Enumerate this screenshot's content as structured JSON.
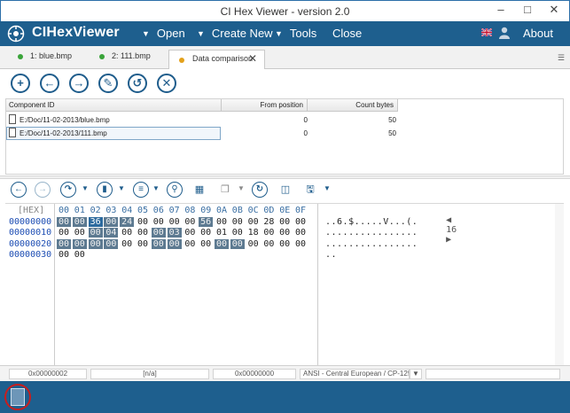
{
  "window": {
    "title": "CI Hex Viewer - version 2.0"
  },
  "appbar": {
    "app_name": "CIHexViewer",
    "menu": {
      "open": "Open",
      "create_new": "Create New",
      "tools": "Tools",
      "close": "Close",
      "about": "About"
    }
  },
  "tabs": [
    {
      "label": "1: blue.bmp",
      "dot_color": "#3aa43a"
    },
    {
      "label": "2: 111.bmp",
      "dot_color": "#3aa43a"
    },
    {
      "label": "Data comparison",
      "dot_color": "#e3a11b"
    }
  ],
  "component_table": {
    "headers": {
      "id": "Component ID",
      "from": "From position",
      "count": "Count bytes"
    },
    "rows": [
      {
        "id": "E:/Doc/11-02-2013/blue.bmp",
        "from": "0",
        "count": "50"
      },
      {
        "id": "E:/Doc/11-02-2013/111.bmp",
        "from": "0",
        "count": "50"
      }
    ]
  },
  "hexview": {
    "header_label": "[HEX]",
    "columns": [
      "00",
      "01",
      "02",
      "03",
      "04",
      "05",
      "06",
      "07",
      "08",
      "09",
      "0A",
      "0B",
      "0C",
      "0D",
      "0E",
      "0F"
    ],
    "ascii_header": "16",
    "rows": [
      {
        "addr": "00000000",
        "bytes": [
          "00",
          "00",
          "36",
          "00",
          "24",
          "00",
          "00",
          "00",
          "00",
          "56",
          "00",
          "00",
          "00",
          "28",
          "00",
          "00"
        ],
        "ascii": "..6.$.....V...(."
      },
      {
        "addr": "00000010",
        "bytes": [
          "00",
          "00",
          "00",
          "04",
          "00",
          "00",
          "00",
          "03",
          "00",
          "00",
          "01",
          "00",
          "18",
          "00",
          "00",
          "00"
        ],
        "ascii": "................"
      },
      {
        "addr": "00000020",
        "bytes": [
          "00",
          "00",
          "00",
          "00",
          "00",
          "00",
          "00",
          "00",
          "00",
          "00",
          "00",
          "00",
          "00",
          "00",
          "00",
          "00"
        ],
        "ascii": "................"
      },
      {
        "addr": "00000030",
        "bytes": [
          "00",
          "00"
        ],
        "ascii": ".."
      }
    ]
  },
  "statusbar": {
    "position": "0x00000002",
    "value": "[n/a]",
    "selection": "0x00000000",
    "encoding": "ANSI - Central European / CP-1250"
  },
  "colors": {
    "accent": "#1e5f8e",
    "highlight": "#5d7a91",
    "address": "#1f4fb4"
  }
}
